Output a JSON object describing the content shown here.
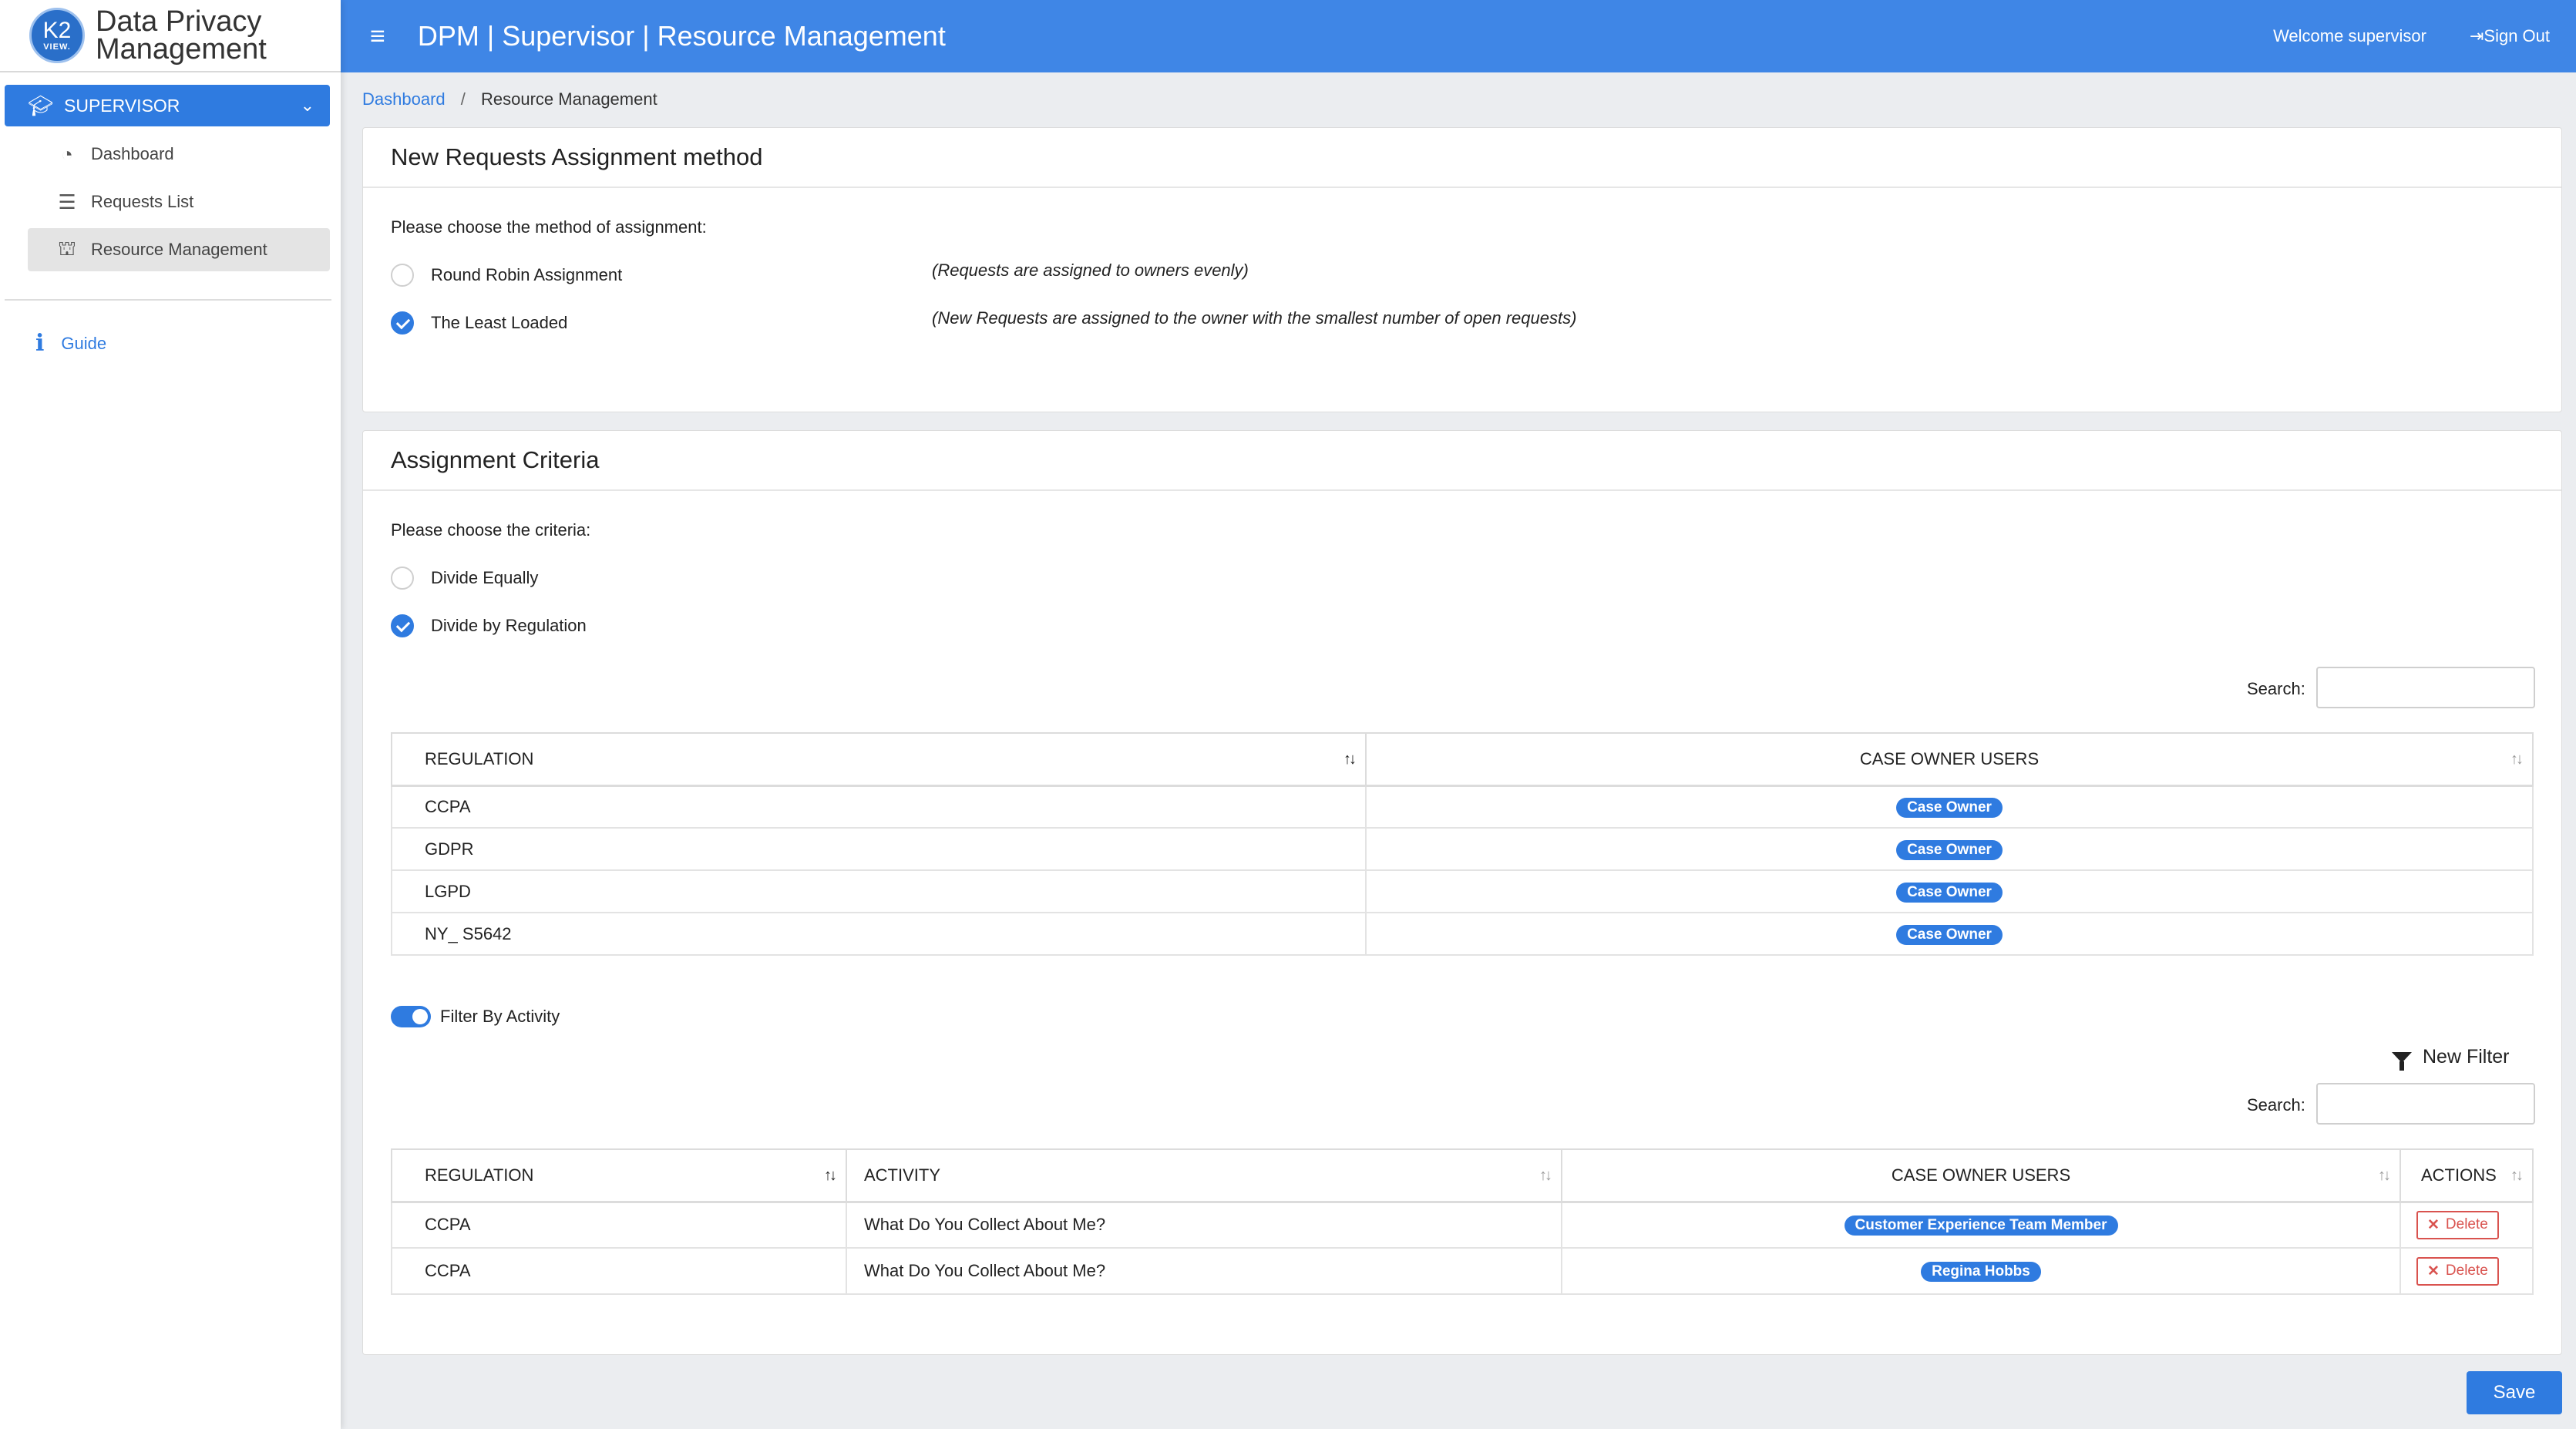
{
  "brand": {
    "logo_top": "K2",
    "logo_bottom": "VIEW.",
    "line1": "Data Privacy",
    "line2": "Management"
  },
  "header": {
    "title": "DPM | Supervisor | Resource Management",
    "welcome": "Welcome supervisor",
    "signout": "Sign Out"
  },
  "sidebar": {
    "section": "SUPERVISOR",
    "items": [
      {
        "label": "Dashboard",
        "icon": "tachometer-icon"
      },
      {
        "label": "Requests List",
        "icon": "list-icon"
      },
      {
        "label": "Resource Management",
        "icon": "sitemap-icon"
      }
    ],
    "guide": "Guide"
  },
  "breadcrumb": {
    "home": "Dashboard",
    "current": "Resource Management"
  },
  "assignment": {
    "title": "New Requests Assignment method",
    "prompt": "Please choose the method of assignment:",
    "options": [
      {
        "label": "Round Robin Assignment",
        "hint": "(Requests are assigned to owners evenly)",
        "checked": false
      },
      {
        "label": "The Least Loaded",
        "hint": "(New Requests are assigned to the owner with the smallest number of open requests)",
        "checked": true
      }
    ]
  },
  "criteria": {
    "title": "Assignment Criteria",
    "prompt": "Please choose the criteria:",
    "options": [
      {
        "label": "Divide Equally",
        "checked": false
      },
      {
        "label": "Divide by Regulation",
        "checked": true
      }
    ],
    "search_label": "Search:",
    "table1": {
      "headers": [
        "REGULATION",
        "CASE OWNER USERS"
      ],
      "rows": [
        {
          "regulation": "CCPA",
          "owner": "Case Owner"
        },
        {
          "regulation": "GDPR",
          "owner": "Case Owner"
        },
        {
          "regulation": "LGPD",
          "owner": "Case Owner"
        },
        {
          "regulation": "NY_ S5642",
          "owner": "Case Owner"
        }
      ]
    },
    "filter_toggle": {
      "label": "Filter By Activity",
      "on": true
    },
    "new_filter": "New Filter",
    "search_label2": "Search:",
    "table2": {
      "headers": [
        "REGULATION",
        "ACTIVITY",
        "CASE OWNER USERS",
        "ACTIONS"
      ],
      "rows": [
        {
          "regulation": "CCPA",
          "activity": "What Do You Collect About Me?",
          "owner": "Customer Experience Team Member",
          "action": "Delete"
        },
        {
          "regulation": "CCPA",
          "activity": "What Do You Collect About Me?",
          "owner": "Regina Hobbs",
          "action": "Delete"
        }
      ]
    }
  },
  "save_label": "Save",
  "colors": {
    "primary": "#2f7be0",
    "header": "#3f86e6",
    "danger": "#d9534f"
  }
}
